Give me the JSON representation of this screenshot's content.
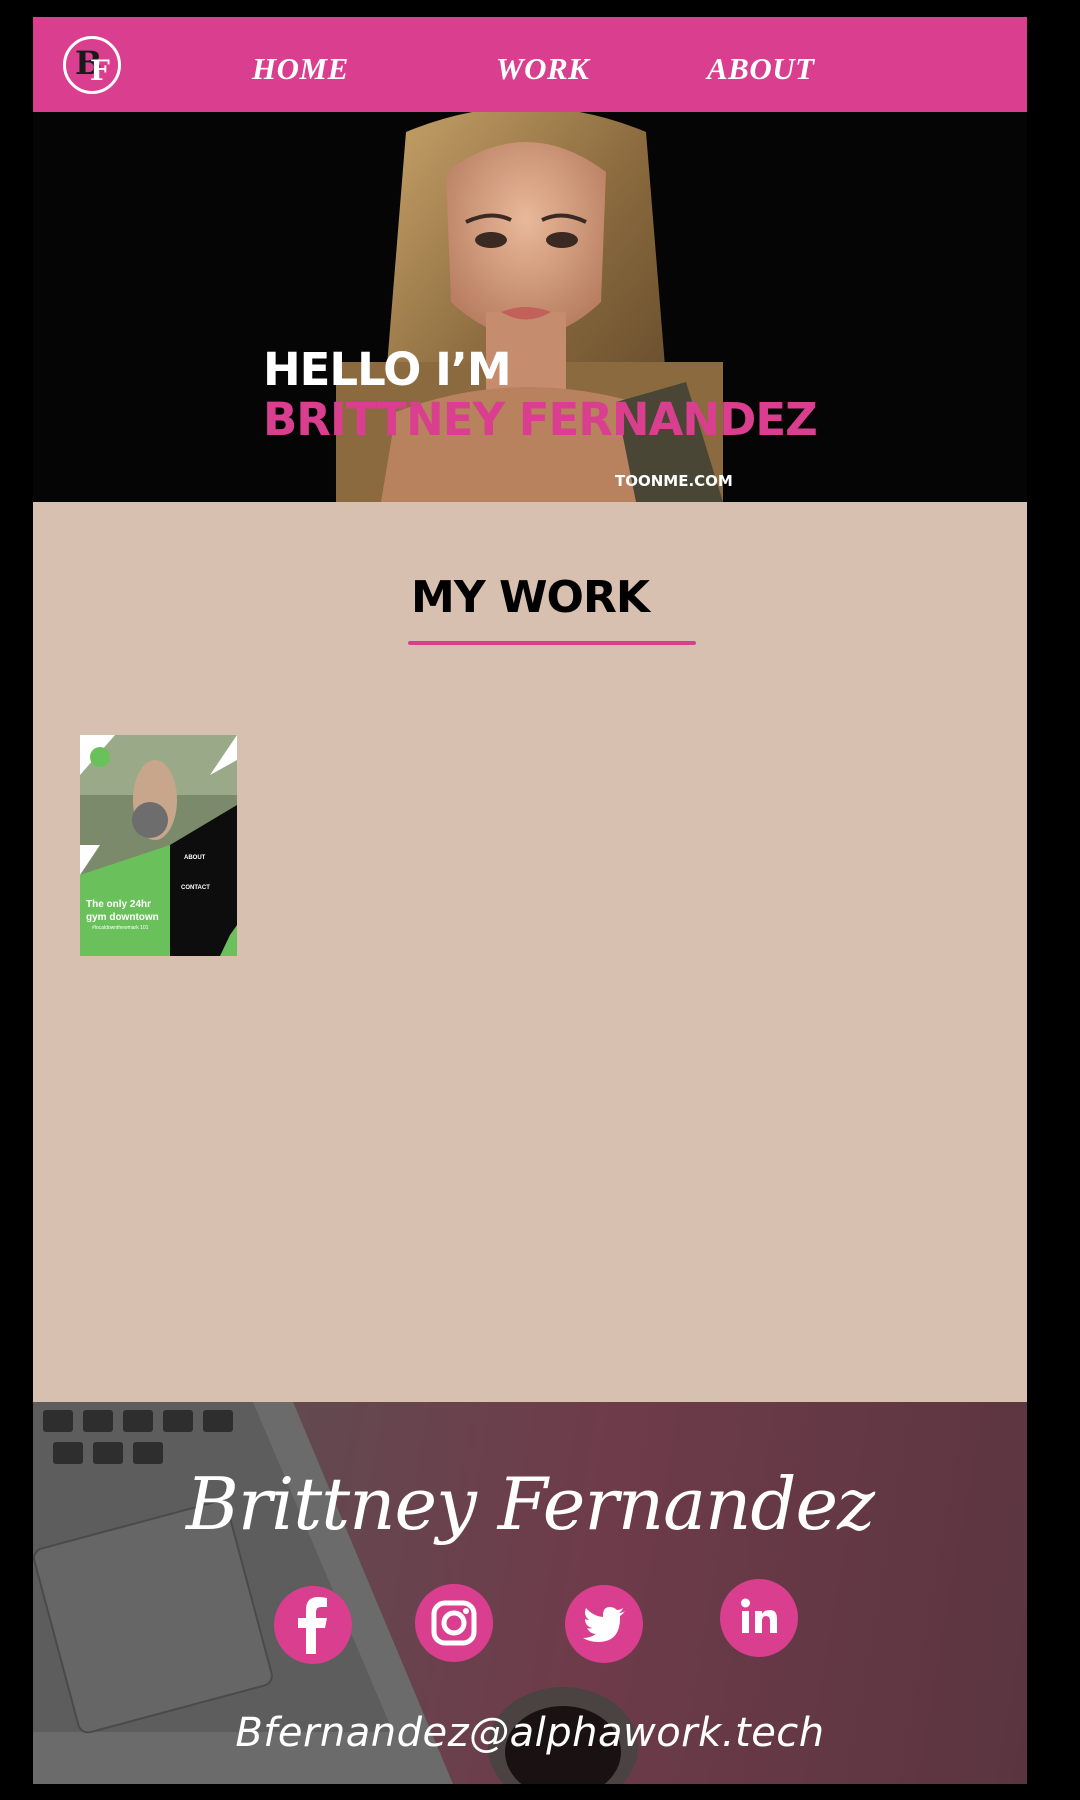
{
  "header": {
    "logo": {
      "b": "B",
      "f": "F"
    },
    "nav": [
      {
        "label": "HOME"
      },
      {
        "label": "WORK"
      },
      {
        "label": "ABOUT"
      }
    ]
  },
  "hero": {
    "greeting": "HELLO I’M",
    "name": "BRITTNEY FERNANDEZ",
    "credit": "TOONME.COM"
  },
  "work": {
    "title": "MY WORK",
    "items": [
      {
        "headline": "The only 24hr gym downtown",
        "subline": "#localdownthewmark 101",
        "about_label": "ABOUT",
        "contact_label": "CONTACT"
      }
    ]
  },
  "footer": {
    "signature": "Brittney Fernandez",
    "social": [
      "facebook",
      "instagram",
      "twitter",
      "linkedin"
    ],
    "email": "Bfernandez@alphawork.tech"
  },
  "colors": {
    "accent": "#d93f8e",
    "work_bg": "#d8c0b0",
    "hero_bg": "#050505"
  }
}
